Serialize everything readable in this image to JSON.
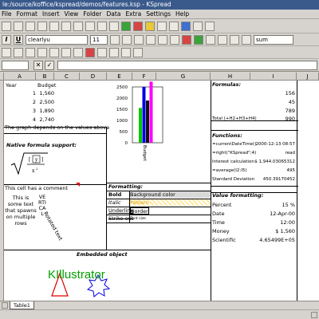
{
  "window": {
    "title": "le:/source/koffice/kspread/demos/features.ksp - KSpread"
  },
  "menu": [
    "File",
    "Format",
    "Insert",
    "View",
    "Folder",
    "Data",
    "Extra",
    "Settings",
    "Help"
  ],
  "toolbar": {
    "font_name": "clearlyu",
    "font_size": "11",
    "sum_label": "sum",
    "italic_label": "I",
    "underline_label": "U"
  },
  "formula_bar": {
    "cancel_label": "✕",
    "accept_label": "✓"
  },
  "columns": [
    "A",
    "B",
    "C",
    "D",
    "E",
    "F",
    "G",
    "H",
    "I",
    "J"
  ],
  "cells": {
    "year_label": "Year",
    "budget_label": "Budget",
    "years": [
      "1",
      "2",
      "3",
      "4"
    ],
    "budgets": [
      "1,560",
      "2,500",
      "1,890",
      "2,740"
    ],
    "graph_note": "The graph depends on the values above",
    "native_formula_title": "Native formula support:",
    "comment_note": "This cell has a comment",
    "multirow_text": "This is some text that spawns on multiple rows",
    "vertical_text": "VERTICAL",
    "rotated_text": "Rotated text",
    "formatting_title": "Formatting:",
    "fmt_labels": [
      "Bold",
      "Italic",
      "Underline",
      "Strike out"
    ],
    "fmt_values": [
      "Background color",
      "Pattern",
      "Border",
      "Font size"
    ],
    "embedded_title": "Embedded object",
    "killustrator": "KIllustrator",
    "formulas_title": "Formulas:",
    "formula_values": [
      "156",
      "45",
      "789",
      "990"
    ],
    "total_label": "Total (+H2+H3+H4)",
    "functions_title": "Functions:",
    "functions": [
      {
        "name": "=currentDateTime()",
        "value": "2000-12-13 08:57"
      },
      {
        "name": "=right(\"KSpread\";4)",
        "value": "read"
      },
      {
        "name": "Interest calculation",
        "value": "$ 1,944.03065312"
      },
      {
        "name": "=average(I2:I5)",
        "value": "495"
      },
      {
        "name": "Standard Deviation",
        "value": "450.39170452"
      }
    ],
    "value_fmt_title": "Value formatting:",
    "value_fmt": [
      {
        "name": "Percent",
        "value": "15 %"
      },
      {
        "name": "Date",
        "value": "12-Apr-00"
      },
      {
        "name": "Time",
        "value": "12:00"
      },
      {
        "name": "Money",
        "value": "$ 1,560"
      },
      {
        "name": "Scientific",
        "value": "4.65499E+05"
      }
    ]
  },
  "sheet_tab": "Table1",
  "chart_data": {
    "type": "bar",
    "categories": [
      "1",
      "2",
      "3",
      "4"
    ],
    "values": [
      1560,
      2500,
      1890,
      2740
    ],
    "colors": [
      "#00c800",
      "#0000e0",
      "#101010",
      "#ff00ff"
    ],
    "ylim": [
      0,
      2500
    ],
    "yticks": [
      "2500",
      "2000",
      "1500",
      "1000",
      "500",
      "0"
    ],
    "xlabel": "Budget"
  }
}
